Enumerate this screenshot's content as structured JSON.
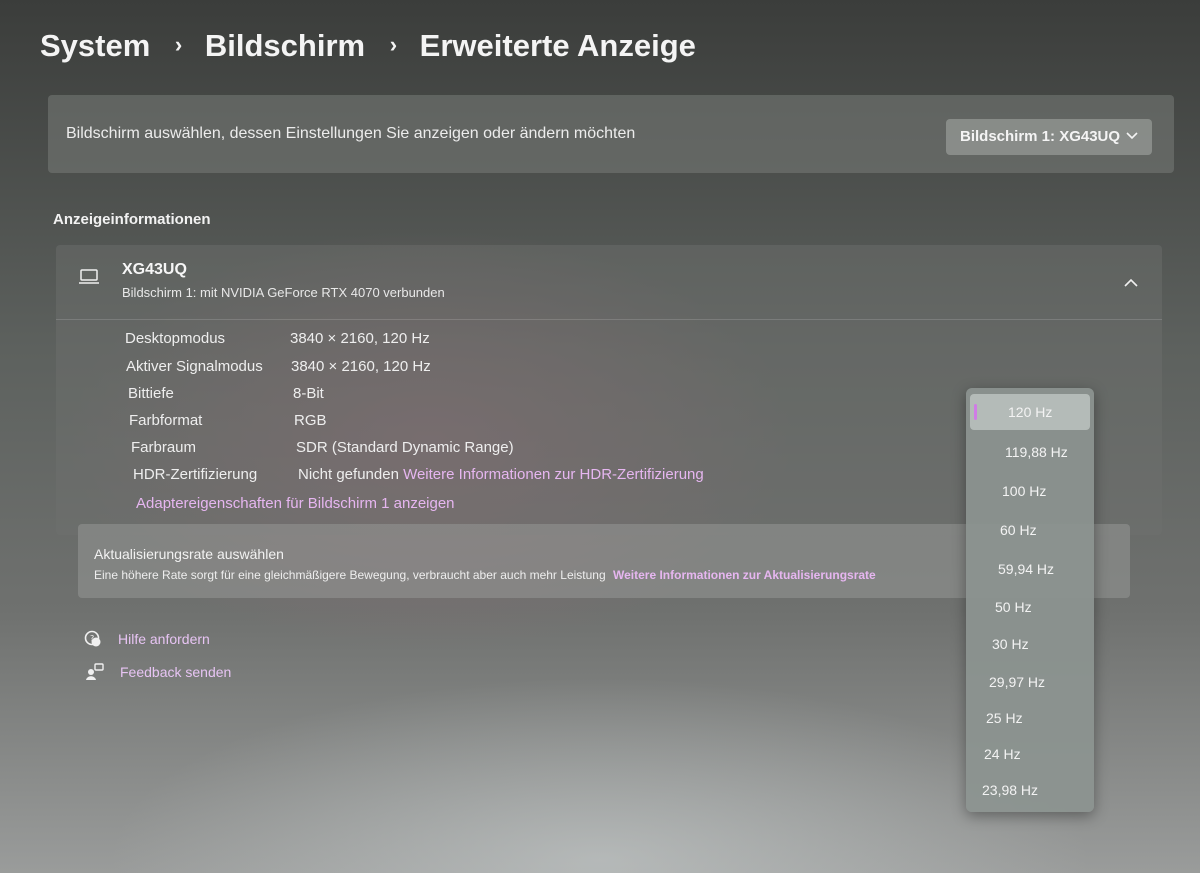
{
  "breadcrumb": [
    "System",
    "Bildschirm",
    "Erweiterte Anzeige"
  ],
  "monitor_select": {
    "label": "Bildschirm auswählen, dessen Einstellungen Sie anzeigen oder ändern möchten",
    "value": "Bildschirm 1: XG43UQ"
  },
  "display_info": {
    "title": "Anzeigeinformationen",
    "monitor_name": "XG43UQ",
    "monitor_sub": "Bildschirm 1: mit NVIDIA GeForce RTX 4070 verbunden",
    "rows": [
      {
        "label": "Desktopmodus",
        "value": "3840 × 2160, 120 Hz"
      },
      {
        "label": "Aktiver Signalmodus",
        "value": "3840 × 2160, 120 Hz"
      },
      {
        "label": "Bittiefe",
        "value": "8-Bit"
      },
      {
        "label": "Farbformat",
        "value": "RGB"
      },
      {
        "label": "Farbraum",
        "value": "SDR (Standard Dynamic Range)"
      },
      {
        "label": "HDR-Zertifizierung",
        "value": "Nicht gefunden",
        "link": "Weitere Informationen zur HDR-Zertifizierung"
      }
    ],
    "adapter_link": "Adaptereigenschaften für Bildschirm 1 anzeigen"
  },
  "refresh_rate": {
    "title": "Aktualisierungsrate auswählen",
    "description": "Eine höhere Rate sorgt für eine gleichmäßigere Bewegung, verbraucht aber auch mehr Leistung",
    "link": "Weitere Informationen zur Aktualisierungsrate",
    "selected": "120 Hz",
    "options": [
      "120 Hz",
      "119,88 Hz",
      "100 Hz",
      "60 Hz",
      "59,94 Hz",
      "50 Hz",
      "30 Hz",
      "29,97 Hz",
      "25 Hz",
      "24 Hz",
      "23,98 Hz"
    ]
  },
  "help": {
    "get_help": "Hilfe anfordern",
    "feedback": "Feedback senden"
  },
  "colors": {
    "accent": "#d07be6",
    "link": "#e6b6f0"
  },
  "icons": {
    "monitor": "laptop-icon",
    "collapse": "chevron-up-icon",
    "dropdown": "chevron-down-icon",
    "help": "help-chat-icon",
    "feedback": "feedback-icon"
  }
}
